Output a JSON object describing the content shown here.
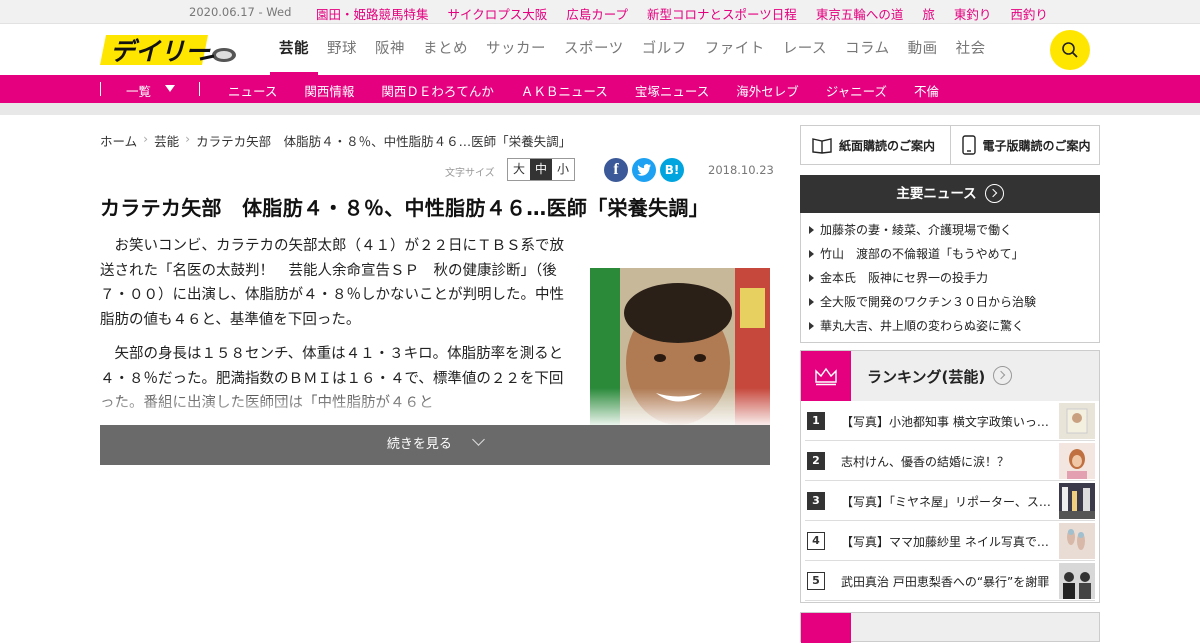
{
  "topbar": {
    "date": "2020.06.17 - Wed",
    "links": [
      "園田・姫路競馬特集",
      "サイクロプス大阪",
      "広島カープ",
      "新型コロナとスポーツ日程",
      "東京五輪への道",
      "旅",
      "東釣り",
      "西釣り"
    ]
  },
  "header": {
    "logo_alt": "デイリー",
    "nav": [
      "芸能",
      "野球",
      "阪神",
      "まとめ",
      "サッカー",
      "スポーツ",
      "ゴルフ",
      "ファイト",
      "レース",
      "コラム",
      "動画",
      "社会"
    ],
    "active_nav": "芸能"
  },
  "subnav": {
    "dropdown": "一覧",
    "links": [
      "ニュース",
      "関西情報",
      "関西ＤＥわろてんか",
      "ＡＫＢニュース",
      "宝塚ニュース",
      "海外セレブ",
      "ジャニーズ",
      "不倫"
    ]
  },
  "breadcrumb": [
    "ホーム",
    "芸能",
    "カラテカ矢部　体脂肪４・８％、中性脂肪４６…医師「栄養失調」"
  ],
  "article": {
    "font_label": "文字サイズ",
    "font_sizes": [
      "大",
      "中",
      "小"
    ],
    "font_selected": "中",
    "share": [
      "f",
      "t",
      "B!"
    ],
    "date": "2018.10.23",
    "title": "カラテカ矢部　体脂肪４・８％、中性脂肪４６…医師「栄養失調」",
    "paragraphs": [
      "お笑いコンビ、カラテカの矢部太郎（４１）が２２日にＴＢＳ系で放送された「名医の太鼓判！　芸能人余命宣告ＳＰ　秋の健康診断」（後７・００）に出演し、体脂肪が４・８％しかないことが判明した。中性脂肪の値も４６と、基準値を下回った。",
      "矢部の身長は１５８センチ、体重は４１・３キロ。体脂肪率を測ると４・８％だった。肥満指数のＢＭＩは１６・４で、標準値の２２を下回った。番組に出演した医師団は「中性脂肪が４６と"
    ],
    "more_label": "続きを見る"
  },
  "sidebar": {
    "subscribe": [
      "紙面購読のご案内",
      "電子版購読のご案内"
    ],
    "major_news_title": "主要ニュース",
    "major_news": [
      "加藤茶の妻・綾菜、介護現場で働く",
      "竹山　渡部の不倫報道「もうやめて」",
      "金本氏　阪神にセ界一の投手力",
      "全大阪で開発のワクチン３０日から治験",
      "華丸大吉、井上順の変わらぬ姿に驚く"
    ],
    "ranking_title": "ランキング(芸能)",
    "ranking": [
      {
        "rank": "1",
        "title": "【写真】小池都知事 横文字政策いっ…"
      },
      {
        "rank": "2",
        "title": "志村けん、優香の結婚に涙！？"
      },
      {
        "rank": "3",
        "title": "【写真】「ミヤネ屋」リポーター、ス…"
      },
      {
        "rank": "4",
        "title": "【写真】ママ加藤紗里 ネイル写真で…"
      },
      {
        "rank": "5",
        "title": "武田真治 戸田恵梨香への“暴行”を謝罪"
      }
    ]
  },
  "colors": {
    "accent": "#e4007f",
    "logo_yellow": "#ffe600",
    "dark": "#333333"
  }
}
